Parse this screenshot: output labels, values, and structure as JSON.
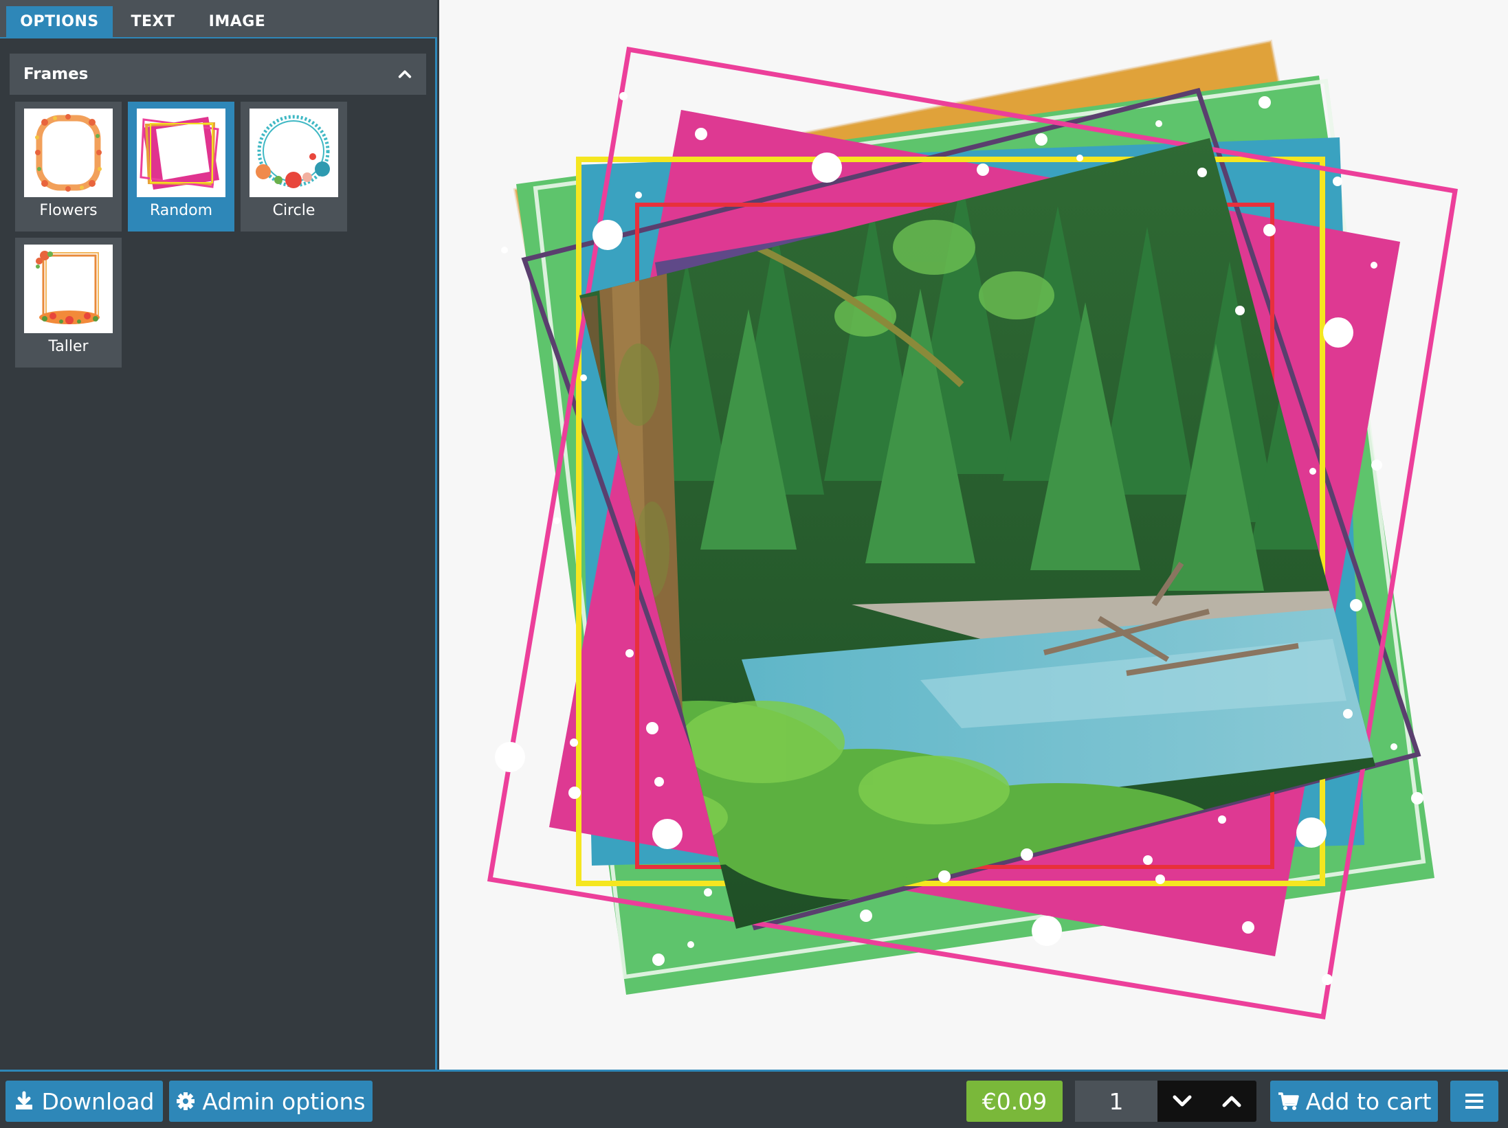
{
  "tabs": [
    {
      "label": "OPTIONS",
      "active": true
    },
    {
      "label": "TEXT",
      "active": false
    },
    {
      "label": "IMAGE",
      "active": false
    }
  ],
  "frames": {
    "header": "Frames",
    "items": [
      {
        "label": "Flowers",
        "selected": false
      },
      {
        "label": "Random",
        "selected": true
      },
      {
        "label": "Circle",
        "selected": false
      },
      {
        "label": "Taller",
        "selected": false
      }
    ]
  },
  "toolbar": {
    "download_label": "Download",
    "admin_label": "Admin options",
    "price": "€0.09",
    "quantity": "1",
    "add_to_cart_label": "Add to cart"
  },
  "icons": {
    "download": "download-icon",
    "admin": "gear-icon",
    "collapse": "chevron-up-icon",
    "qty_down": "chevron-down-icon",
    "qty_up": "chevron-up-icon",
    "cart": "cart-icon",
    "menu": "hamburger-menu-icon"
  },
  "colors": {
    "accent": "#2e87b8",
    "panel": "#343a3f",
    "panel_light": "#4b5258",
    "price": "#7ab83a",
    "canvas": "#f7f7f7"
  }
}
